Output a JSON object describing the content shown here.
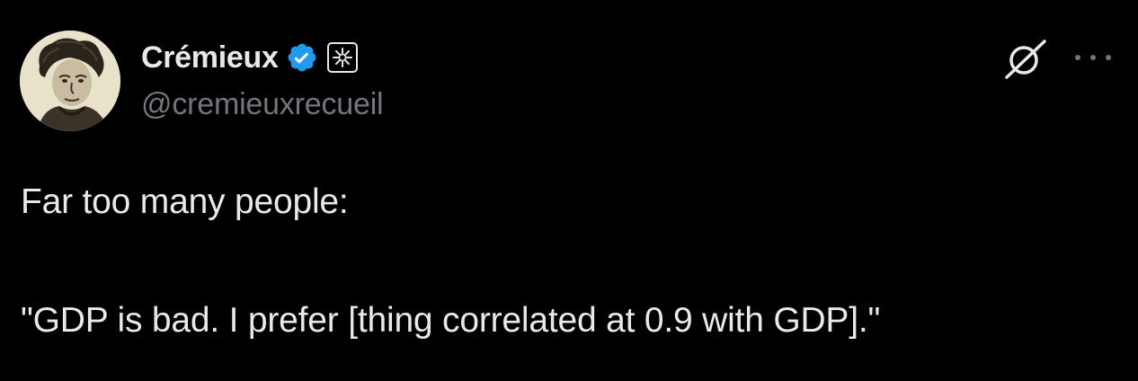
{
  "author": {
    "display_name": "Crémieux",
    "handle": "@cremieuxrecueil",
    "verified_icon": "verified-badge-icon",
    "affiliate_icon": "affiliate-badge-icon",
    "avatar_icon": "profile-portrait"
  },
  "colors": {
    "background": "#000000",
    "text_primary": "#e7e9ea",
    "text_secondary": "#71767b",
    "verified_blue": "#1d9bf0"
  },
  "actions": {
    "grok_icon": "grok-icon",
    "more_icon": "more-options-icon"
  },
  "tweet": {
    "lines": [
      "Far too many people:",
      "\"GDP is bad. I prefer [thing correlated at 0.9 with GDP].\""
    ]
  }
}
